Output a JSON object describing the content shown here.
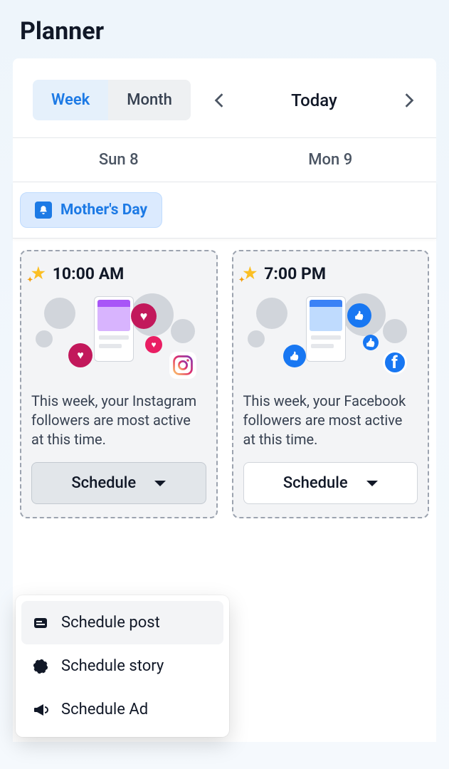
{
  "title": "Planner",
  "toolbar": {
    "view_week": "Week",
    "view_month": "Month",
    "today_label": "Today"
  },
  "days": {
    "sun": "Sun 8",
    "mon": "Mon 9"
  },
  "event": {
    "label": "Mother's Day"
  },
  "cards": [
    {
      "time": "10:00 AM",
      "desc": "This week, your Instagram followers are most active at this time.",
      "schedule_label": "Schedule",
      "platform": "instagram"
    },
    {
      "time": "7:00 PM",
      "desc": "This week, your Facebook followers are most active at this time.",
      "schedule_label": "Schedule",
      "platform": "facebook"
    }
  ],
  "dropdown": {
    "schedule_post": "Schedule post",
    "schedule_story": "Schedule story",
    "schedule_ad": "Schedule Ad"
  }
}
